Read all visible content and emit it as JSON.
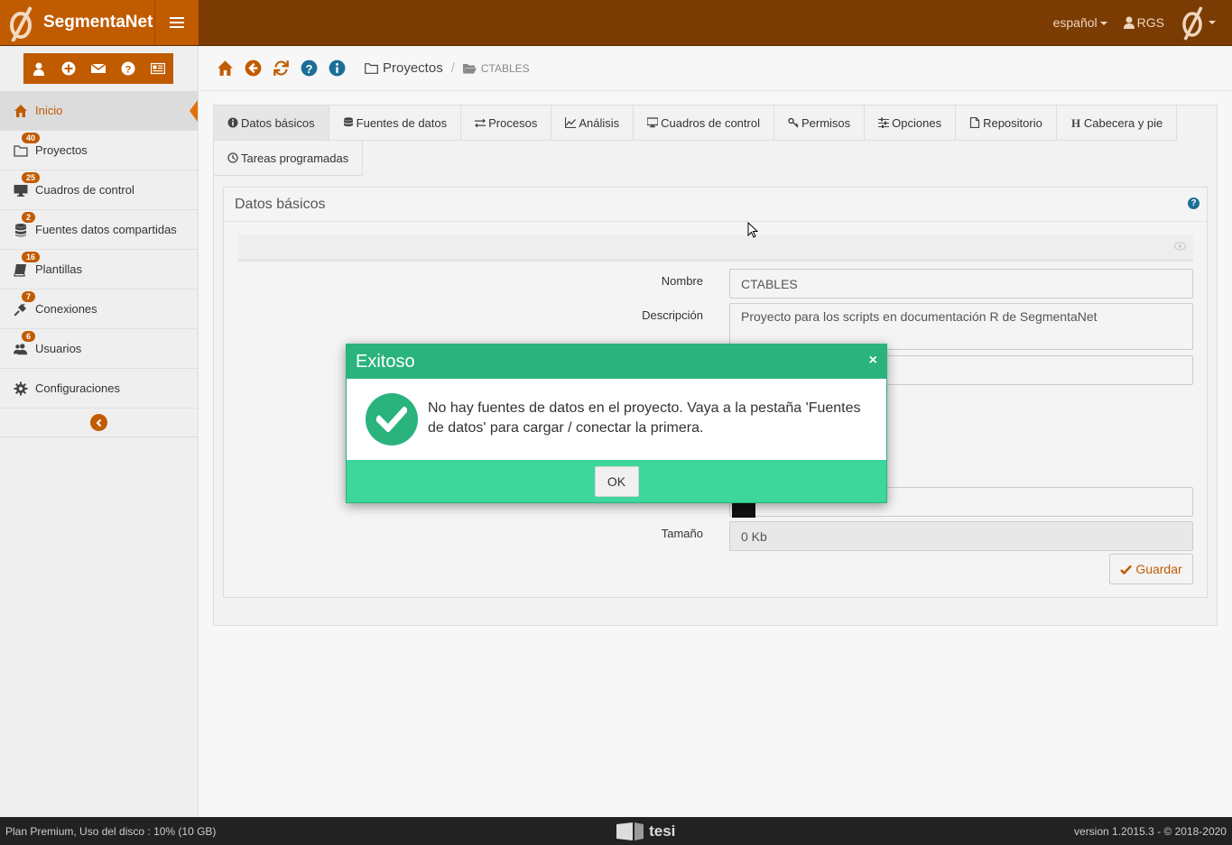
{
  "header": {
    "brand": "SegmentaNet",
    "language": "español",
    "user": "RGS"
  },
  "sidebar": {
    "items": [
      {
        "label": "Inicio",
        "badge": ""
      },
      {
        "label": "Proyectos",
        "badge": "40"
      },
      {
        "label": "Cuadros de control",
        "badge": "25"
      },
      {
        "label": "Fuentes datos compartidas",
        "badge": "2"
      },
      {
        "label": "Plantillas",
        "badge": "16"
      },
      {
        "label": "Conexiones",
        "badge": "7"
      },
      {
        "label": "Usuarios",
        "badge": "6"
      },
      {
        "label": "Configuraciones",
        "badge": ""
      }
    ]
  },
  "breadcrumb": {
    "parent": "Proyectos",
    "current": "CTABLES"
  },
  "tabs": [
    "Datos básicos",
    "Fuentes de datos",
    "Procesos",
    "Análisis",
    "Cuadros de control",
    "Permisos",
    "Opciones",
    "Repositorio",
    "Cabecera y pie",
    "Tareas programadas"
  ],
  "panel": {
    "title": "Datos básicos",
    "fields": {
      "nombre_label": "Nombre",
      "nombre_value": "CTABLES",
      "descripcion_label": "Descripción",
      "descripcion_value": "Proyecto para los scripts en documentación R de SegmentaNet",
      "tamano_label": "Tamaño",
      "tamano_value": "0 Kb"
    },
    "save_label": "Guardar"
  },
  "modal": {
    "title": "Exitoso",
    "close": "×",
    "message": "No hay fuentes de datos en el proyecto. Vaya a la pestaña 'Fuentes de datos' para cargar / conectar la primera.",
    "ok_label": "OK"
  },
  "footer": {
    "plan": "Plan Premium, Uso del disco : 10% (10 GB)",
    "logo_text": "tesi",
    "version": "version 1.2015.3 - © 2018-2020"
  },
  "colors": {
    "brand_orange": "#c15b00",
    "header_brown": "#7a3c02",
    "success_green": "#2ab37d"
  }
}
